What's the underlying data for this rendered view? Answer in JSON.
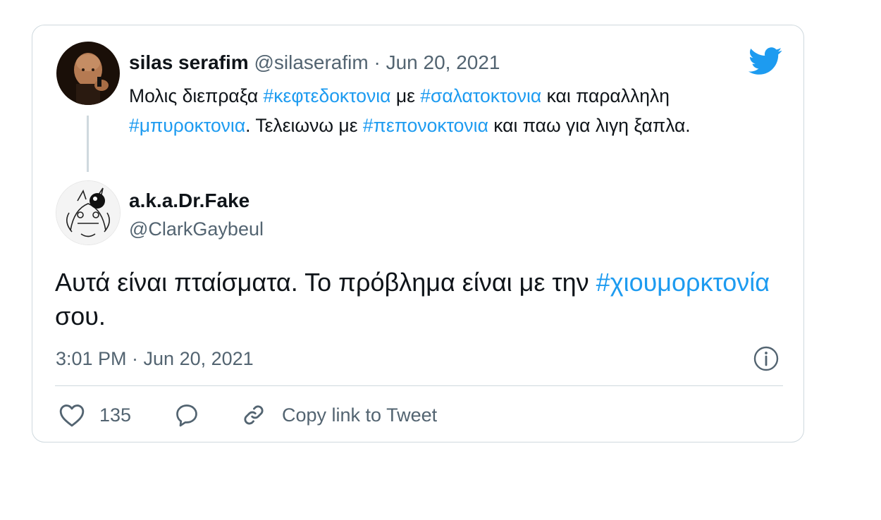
{
  "reply": {
    "name": "silas serafim",
    "handle": "@silaserafim",
    "separator": "·",
    "date": "Jun 20, 2021",
    "text_1": "Μολις διεπραξα ",
    "tag_1": "#κεφτεδοκτονια",
    "text_2": " με ",
    "tag_2": "#σαλατοκτονια",
    "text_3": " και παραλληλη ",
    "tag_3": "#μπυροκτονια",
    "text_4": ". Τελειωνω με ",
    "tag_4": "#πεπονοκτονια",
    "text_5": " και παω για λιγη ξαπλα."
  },
  "tweet": {
    "name": "a.k.a.Dr.Fake",
    "handle": "@ClarkGaybeul",
    "text_1": "Αυτά είναι πταίσματα. Το πρόβλημα είναι με την ",
    "tag_1": "#χιουμορκτονία",
    "text_2": " σου.",
    "timestamp": "3:01 PM · Jun 20, 2021"
  },
  "actions": {
    "like_count": "135",
    "copy_link_label": "Copy link to Tweet"
  },
  "icons": {
    "logo": "twitter-bird-icon",
    "info": "info-icon",
    "like": "heart-icon",
    "reply": "reply-bubble-icon",
    "link": "link-icon"
  },
  "colors": {
    "accent": "#1d9bf0",
    "text": "#0f1419",
    "muted": "#536471",
    "border": "#cfd9de"
  }
}
